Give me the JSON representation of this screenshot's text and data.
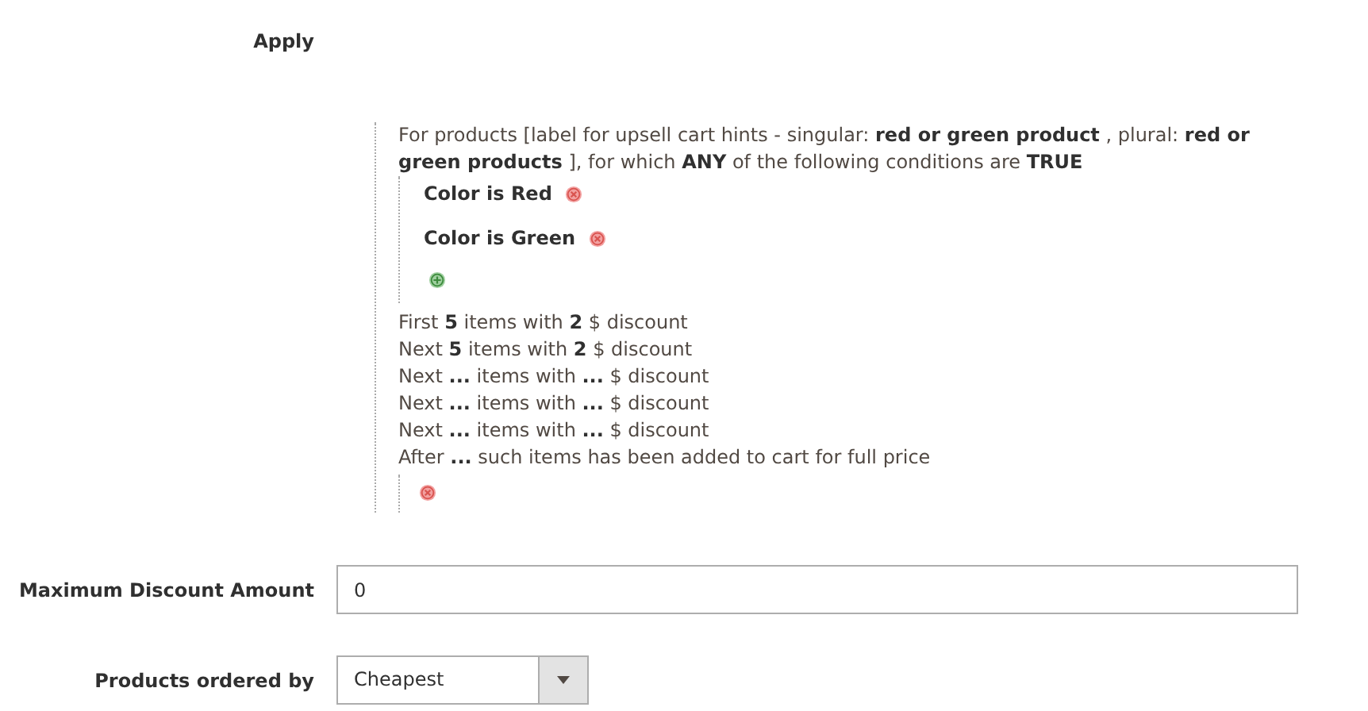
{
  "apply_label": "Apply",
  "rule": {
    "intro": "For products [label for upsell cart hints - singular: **red or green product** , plural: **red or green products** ], for which **ANY**  of the following conditions are **TRUE**",
    "conditions": [
      {
        "text": "Color  is  Red"
      },
      {
        "text": "Color  is  Green"
      }
    ],
    "tiers": [
      "First **5**  items with **2** $ discount",
      "Next **5**  items with **2** $ discount",
      "Next **...**  items with **...** $ discount",
      "Next **...**  items with **...** $ discount",
      "Next **...**  items with **...** $ discount",
      "After **...**  such items has been added to cart for full price"
    ]
  },
  "fields": [
    {
      "kind": "input",
      "label": "Maximum Discount Amount",
      "value": "0"
    },
    {
      "kind": "select",
      "label": "Products ordered by",
      "value": "Cheapest"
    }
  ]
}
